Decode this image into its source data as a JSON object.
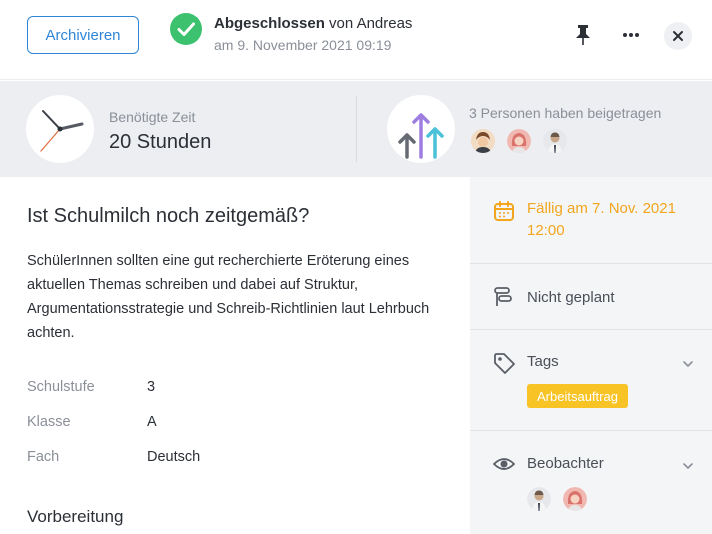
{
  "header": {
    "archive_label": "Archivieren",
    "status_strong": "Abgeschlossen",
    "status_rest": " von Andreas",
    "status_date": "am 9. November 2021 09:19",
    "icons": [
      "check-circle-icon",
      "pin-icon",
      "more-icon",
      "close-icon"
    ]
  },
  "stats": {
    "time_label": "Benötigte Zeit",
    "time_value": "20 Stunden",
    "contributors_label": "3 Personen haben beigetragen"
  },
  "task": {
    "title": "Ist Schulmilch noch zeitgemäß?",
    "description": "SchülerInnen sollten eine gut recherchierte Eröterung eines aktuellen Themas schreiben und dabei auf Struktur, Argumentationsstrategie und Schreib-Richtlinien laut Lehrbuch achten.",
    "meta": [
      {
        "label": "Schulstufe",
        "value": "3"
      },
      {
        "label": "Klasse",
        "value": "A"
      },
      {
        "label": "Fach",
        "value": "Deutsch"
      }
    ],
    "section_title": "Vorbereitung"
  },
  "sidebar": {
    "due_label": "Fällig am 7. Nov. 2021 12:00",
    "planning_label": "Nicht geplant",
    "tags_label": "Tags",
    "tags": [
      "Arbeitsauftrag"
    ],
    "watchers_label": "Beobachter"
  },
  "colors": {
    "accent": "#2f86d6",
    "success": "#3cc16f",
    "due": "#f2a51d",
    "tag": "#f7c325"
  }
}
